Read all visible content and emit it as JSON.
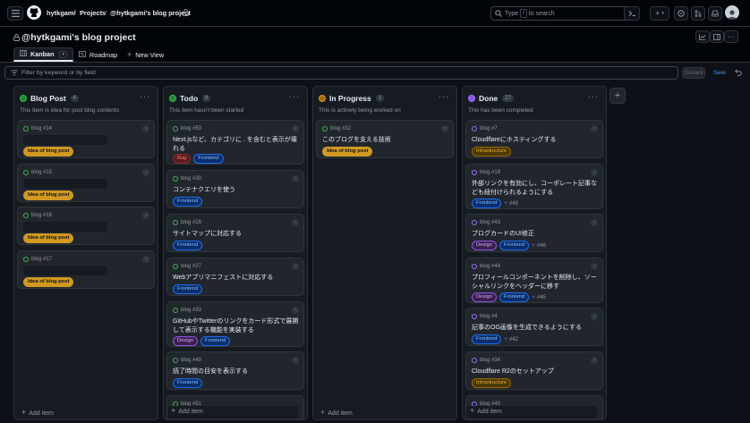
{
  "topbar": {
    "owner": "hytkgami",
    "sep1": "/",
    "projects": "Projects",
    "sep2": "/",
    "project": "@hytkgami's blog project",
    "search_prefix": "Type",
    "search_key": "/",
    "search_suffix": "to search",
    "plus_label": "+"
  },
  "header": {
    "title": "@hytkgami's blog project",
    "tabs": [
      {
        "label": "Kanban"
      },
      {
        "label": "Roadmap"
      },
      {
        "label": "New View"
      }
    ]
  },
  "filter": {
    "placeholder": "Filter by keyword or by field",
    "discard_label": "Discard",
    "save_label": "Save"
  },
  "colors": {
    "green": "#3fb950",
    "yellow": "#d29922",
    "purple": "#a371f7"
  },
  "columns": [
    {
      "name": "Blog Post",
      "count": "4",
      "description": "This item is idea for post blog contents",
      "add_label": "Add item",
      "cards": [
        {
          "id": "blog #14",
          "label": "Idea of blog post"
        },
        {
          "id": "blog #15",
          "label": "Idea of blog post"
        },
        {
          "id": "blog #16",
          "label": "Idea of blog post"
        },
        {
          "id": "blog #17",
          "label": "Idea of blog post"
        }
      ]
    },
    {
      "name": "Todo",
      "count": "8",
      "description": "This item hasn't been started",
      "add_label": "Add item",
      "cards": [
        {
          "id": "blog #53",
          "title": "Next.jsなど、カテゴリに . を含むと表示が壊れる",
          "labels": [
            "Bug",
            "Frontend"
          ]
        },
        {
          "id": "blog #30",
          "title": "コンテナクエリを使う",
          "labels": [
            "Frontend"
          ]
        },
        {
          "id": "blog #28",
          "title": "サイトマップに対応する",
          "labels": [
            "Frontend"
          ]
        },
        {
          "id": "blog #27",
          "title": "Webアプリマニフェストに対応する",
          "labels": [
            "Frontend"
          ]
        },
        {
          "id": "blog #33",
          "title": "GitHubやTwitterのリンクをカード形式で展開して表示する機能を実装する",
          "labels": [
            "Design",
            "Frontend"
          ]
        },
        {
          "id": "blog #49",
          "title": "読了時間の目安を表示する",
          "labels": [
            "Frontend"
          ]
        },
        {
          "id": "blog #51"
        }
      ]
    },
    {
      "name": "In Progress",
      "count": "1",
      "description": "This is actively being worked on",
      "add_label": "Add item",
      "cards": [
        {
          "id": "blog #32",
          "title": "このブログを支える技術",
          "labels": [
            "Idea of blog post"
          ]
        }
      ]
    },
    {
      "name": "Done",
      "count": "27",
      "description": "This has been completed",
      "add_label": "Add item",
      "cards": [
        {
          "id": "blog #7",
          "title": "Cloudflareにホスティングする",
          "labels": [
            "Infrastructure"
          ]
        },
        {
          "id": "blog #19",
          "title": "外部リンクを有効にし、コーポレート記事なども紐付けられるようにする",
          "labels": [
            "Frontend"
          ],
          "pr": "#49"
        },
        {
          "id": "blog #43",
          "title": "ブログカードのUI修正",
          "labels": [
            "Design",
            "Frontend"
          ],
          "pr": "#46"
        },
        {
          "id": "blog #44",
          "title": "プロフィールコンポーネントを削除し、ソーシャルリンクをヘッダーに移す",
          "labels": [
            "Design",
            "Frontend"
          ],
          "pr": "#45"
        },
        {
          "id": "blog #4",
          "title": "記事のOG画像を生成できるようにする",
          "labels": [
            "Frontend"
          ],
          "pr": "#42"
        },
        {
          "id": "blog #34",
          "title": "Cloudflare R2のセットアップ",
          "labels": [
            "Infrastructure"
          ]
        },
        {
          "id": "blog #40"
        }
      ]
    }
  ]
}
